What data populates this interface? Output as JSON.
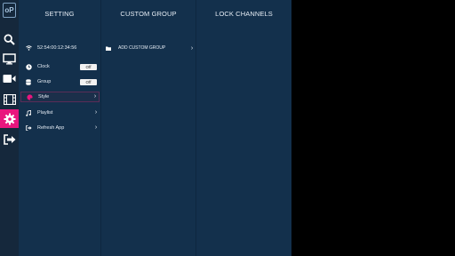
{
  "rail": {
    "logo": "oP",
    "items": [
      {
        "icon": "search-icon"
      },
      {
        "icon": "monitor-icon"
      },
      {
        "icon": "video-camera-icon"
      },
      {
        "icon": "film-icon"
      },
      {
        "icon": "gear-icon",
        "active": true
      },
      {
        "icon": "exit-icon"
      }
    ],
    "accent": "#e9157e"
  },
  "columns": {
    "setting": "SETTING",
    "custom_group": "CUSTOM GROUP",
    "lock_channels": "LOCK CHANNELS"
  },
  "settings": {
    "wifi": {
      "label": "52:54:00:12:34:56",
      "icon": "wifi-icon"
    },
    "clock": {
      "label": "Clock",
      "toggle": "Off",
      "icon": "clock-icon"
    },
    "group": {
      "label": "Group",
      "toggle": "Off",
      "icon": "database-icon"
    },
    "style": {
      "label": "Style",
      "icon": "palette-icon",
      "selected": true
    },
    "playlist": {
      "label": "Playlist",
      "icon": "music-note-icon"
    },
    "refresh": {
      "label": "Refresh App",
      "icon": "refresh-exit-icon"
    }
  },
  "custom_group": {
    "add": {
      "label": "ADD CUSTOM GROUP",
      "icon": "folder-icon"
    }
  },
  "colors": {
    "panel": "#13304c",
    "rail": "#15283c",
    "selected_border": "#5b2d57"
  }
}
